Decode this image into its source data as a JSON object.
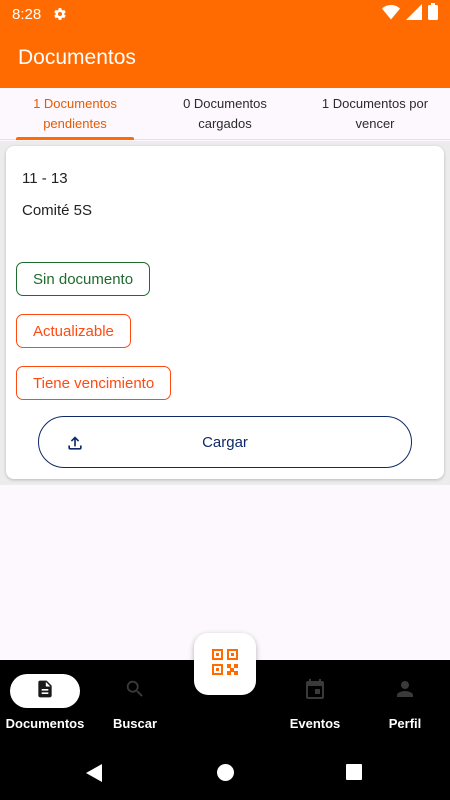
{
  "status_bar": {
    "time": "8:28"
  },
  "app_bar": {
    "title": "Documentos"
  },
  "tabs": [
    {
      "label": "1 Documentos pendientes",
      "active": true
    },
    {
      "label": "0 Documentos cargados",
      "active": false
    },
    {
      "label": "1 Documentos por vencer",
      "active": false
    }
  ],
  "card": {
    "range": "11 - 13",
    "name": "Comité 5S",
    "chips": [
      {
        "label": "Sin documento",
        "color": "#1f6b2e"
      },
      {
        "label": "Actualizable",
        "color": "#ff4a12"
      },
      {
        "label": "Tiene vencimiento",
        "color": "#ff4a12"
      }
    ],
    "upload_label": "Cargar",
    "upload_icon": "upload-icon"
  },
  "bottom_nav": [
    {
      "label": "Documentos",
      "icon": "document-icon",
      "active": true
    },
    {
      "label": "Buscar",
      "icon": "search-icon",
      "active": false
    },
    {
      "label": "Eventos",
      "icon": "calendar-icon",
      "active": false
    },
    {
      "label": "Perfil",
      "icon": "person-icon",
      "active": false
    }
  ],
  "fab": {
    "icon": "qr-code-icon"
  },
  "colors": {
    "primary": "#ff6b00",
    "accent_text": "#e65a00",
    "upload_blue": "#0e2a66"
  }
}
